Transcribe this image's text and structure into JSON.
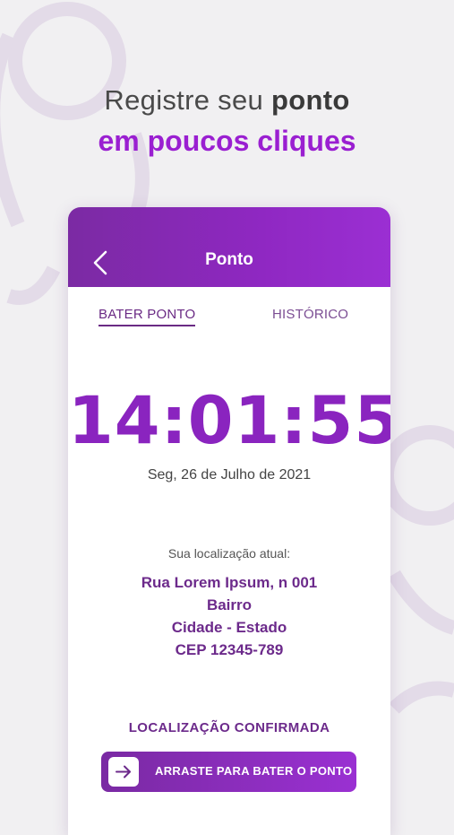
{
  "headline": {
    "line1_regular": "Registre seu",
    "line1_bold": "ponto",
    "line2": "em poucos cliques"
  },
  "appbar": {
    "title": "Ponto",
    "back_icon": "chevron-left-icon"
  },
  "tabs": [
    {
      "label": "BATER PONTO",
      "active": true
    },
    {
      "label": "HISTÓRICO",
      "active": false
    }
  ],
  "clock": {
    "time": "14:01:55",
    "date": "Seg, 26 de Julho de 2021"
  },
  "location": {
    "label": "Sua localização atual:",
    "street": "Rua Lorem Ipsum, n 001",
    "district": "Bairro",
    "city_state": "Cidade - Estado",
    "zip": "CEP 12345-789",
    "status": "LOCALIZAÇÃO CONFIRMADA"
  },
  "slider": {
    "label": "ARRASTE PARA BATER O PONTO",
    "icon": "arrow-right-icon"
  },
  "colors": {
    "accent": "#9a1fd1",
    "appbar": "#8f28c2",
    "text_purple": "#6c2a8b",
    "background": "#f1f0f2"
  }
}
